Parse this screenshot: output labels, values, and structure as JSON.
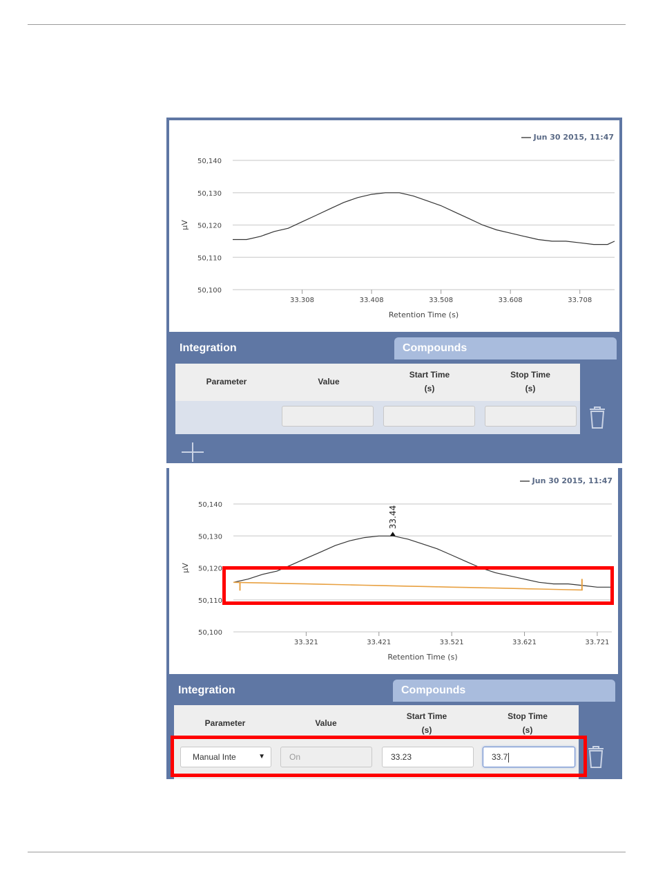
{
  "panel1": {
    "legend": "Jun 30 2015, 11:47",
    "y_ticks": [
      "50,140",
      "50,130",
      "50,120",
      "50,110",
      "50,100"
    ],
    "x_ticks": [
      "33.308",
      "33.408",
      "33.508",
      "33.608",
      "33.708"
    ],
    "ylabel": "µV",
    "xlabel": "Retention Time (s)",
    "tabs": {
      "integration": "Integration",
      "compounds": "Compounds"
    },
    "headers": {
      "parameter": "Parameter",
      "value": "Value",
      "start_time": "Start Time",
      "start_unit": "(s)",
      "stop_time": "Stop Time",
      "stop_unit": "(s)"
    }
  },
  "panel2": {
    "legend": "Jun 30 2015, 11:47",
    "y_ticks": [
      "50,140",
      "50,130",
      "50,120",
      "50,110",
      "50,100"
    ],
    "x_ticks": [
      "33.321",
      "33.421",
      "33.521",
      "33.621",
      "33.721"
    ],
    "ylabel": "µV",
    "xlabel": "Retention Time (s)",
    "peak_label": "33.44",
    "tabs": {
      "integration": "Integration",
      "compounds": "Compounds"
    },
    "headers": {
      "parameter": "Parameter",
      "value": "Value",
      "start_time": "Start Time",
      "start_unit": "(s)",
      "stop_time": "Stop Time",
      "stop_unit": "(s)"
    },
    "row": {
      "parameter": "Manual Inte",
      "value": "On",
      "start": "33.23",
      "stop": "33.7"
    }
  },
  "colors": {
    "panel": "#5f77a4",
    "tab_inactive": "#a9bcdd",
    "highlight": "#ff0000",
    "baseline": "#e8a040",
    "signal": "#333333"
  },
  "chart_data": [
    {
      "type": "line",
      "xlabel": "Retention Time (s)",
      "ylabel": "µV",
      "xlim": [
        33.208,
        33.758
      ],
      "ylim": [
        50100,
        50140
      ],
      "x": [
        33.208,
        33.228,
        33.248,
        33.268,
        33.288,
        33.308,
        33.328,
        33.348,
        33.368,
        33.388,
        33.408,
        33.428,
        33.448,
        33.468,
        33.488,
        33.508,
        33.528,
        33.548,
        33.568,
        33.588,
        33.608,
        33.628,
        33.648,
        33.668,
        33.688,
        33.708,
        33.728,
        33.748,
        33.758
      ],
      "series": [
        {
          "name": "Jun 30 2015, 11:47",
          "values": [
            50115.5,
            50115.5,
            50116.5,
            50118,
            50119,
            50121,
            50123,
            50125,
            50127,
            50128.5,
            50129.5,
            50130,
            50130,
            50129,
            50127.5,
            50126,
            50124,
            50122,
            50120,
            50118.5,
            50117.5,
            50116.5,
            50115.5,
            50115,
            50115,
            50114.5,
            50114,
            50114,
            50115
          ]
        }
      ]
    },
    {
      "type": "line",
      "xlabel": "Retention Time (s)",
      "ylabel": "µV",
      "xlim": [
        33.221,
        33.741
      ],
      "ylim": [
        50100,
        50140
      ],
      "x": [
        33.221,
        33.241,
        33.261,
        33.281,
        33.301,
        33.321,
        33.341,
        33.361,
        33.381,
        33.401,
        33.421,
        33.441,
        33.461,
        33.481,
        33.501,
        33.521,
        33.541,
        33.561,
        33.581,
        33.601,
        33.621,
        33.641,
        33.661,
        33.681,
        33.701,
        33.721,
        33.741
      ],
      "series": [
        {
          "name": "Jun 30 2015, 11:47",
          "values": [
            50115.5,
            50116.5,
            50118,
            50119,
            50121,
            50123,
            50125,
            50127,
            50128.5,
            50129.5,
            50130,
            50130,
            50129,
            50127.5,
            50126,
            50124,
            50122,
            50120,
            50118.5,
            50117.5,
            50116.5,
            50115.5,
            50115,
            50115,
            50114.5,
            50114,
            50114
          ]
        },
        {
          "name": "baseline",
          "values": [
            50115.5,
            50115.4,
            50115.3,
            50115.2,
            50115.1,
            50115.0,
            50114.9,
            50114.8,
            50114.7,
            50114.6,
            50114.5,
            50114.4,
            50114.3,
            50114.2,
            50114.1,
            50114.0,
            50113.9,
            50113.8,
            50113.7,
            50113.6,
            50113.5,
            50113.4,
            50113.3,
            50113.2,
            50113.1,
            null,
            null
          ]
        }
      ],
      "annotations": [
        {
          "x": 33.44,
          "label": "33.44"
        }
      ],
      "markers": [
        {
          "x": 33.23
        },
        {
          "x": 33.7
        }
      ]
    }
  ]
}
